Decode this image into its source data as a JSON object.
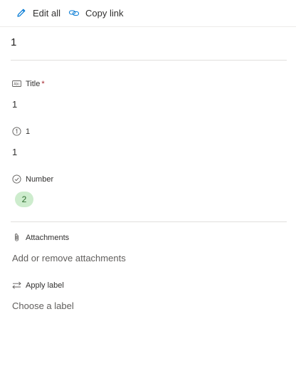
{
  "toolbar": {
    "edit_all_label": "Edit all",
    "copy_link_label": "Copy link",
    "accent_color": "#0078d4"
  },
  "item": {
    "heading": "1"
  },
  "fields": {
    "title": {
      "label": "Title",
      "required_mark": "*",
      "value": "1",
      "icon": "text-field-icon"
    },
    "number_one": {
      "label": "1",
      "value": "1",
      "icon": "info-circle-icon"
    },
    "number": {
      "label": "Number",
      "value": "2",
      "icon": "check-circle-icon",
      "pill_color": "#cdeccd"
    },
    "attachments": {
      "label": "Attachments",
      "value": "Add or remove attachments",
      "icon": "paperclip-icon"
    },
    "apply_label": {
      "label": "Apply label",
      "value": "Choose a label",
      "icon": "swap-arrows-icon"
    }
  }
}
